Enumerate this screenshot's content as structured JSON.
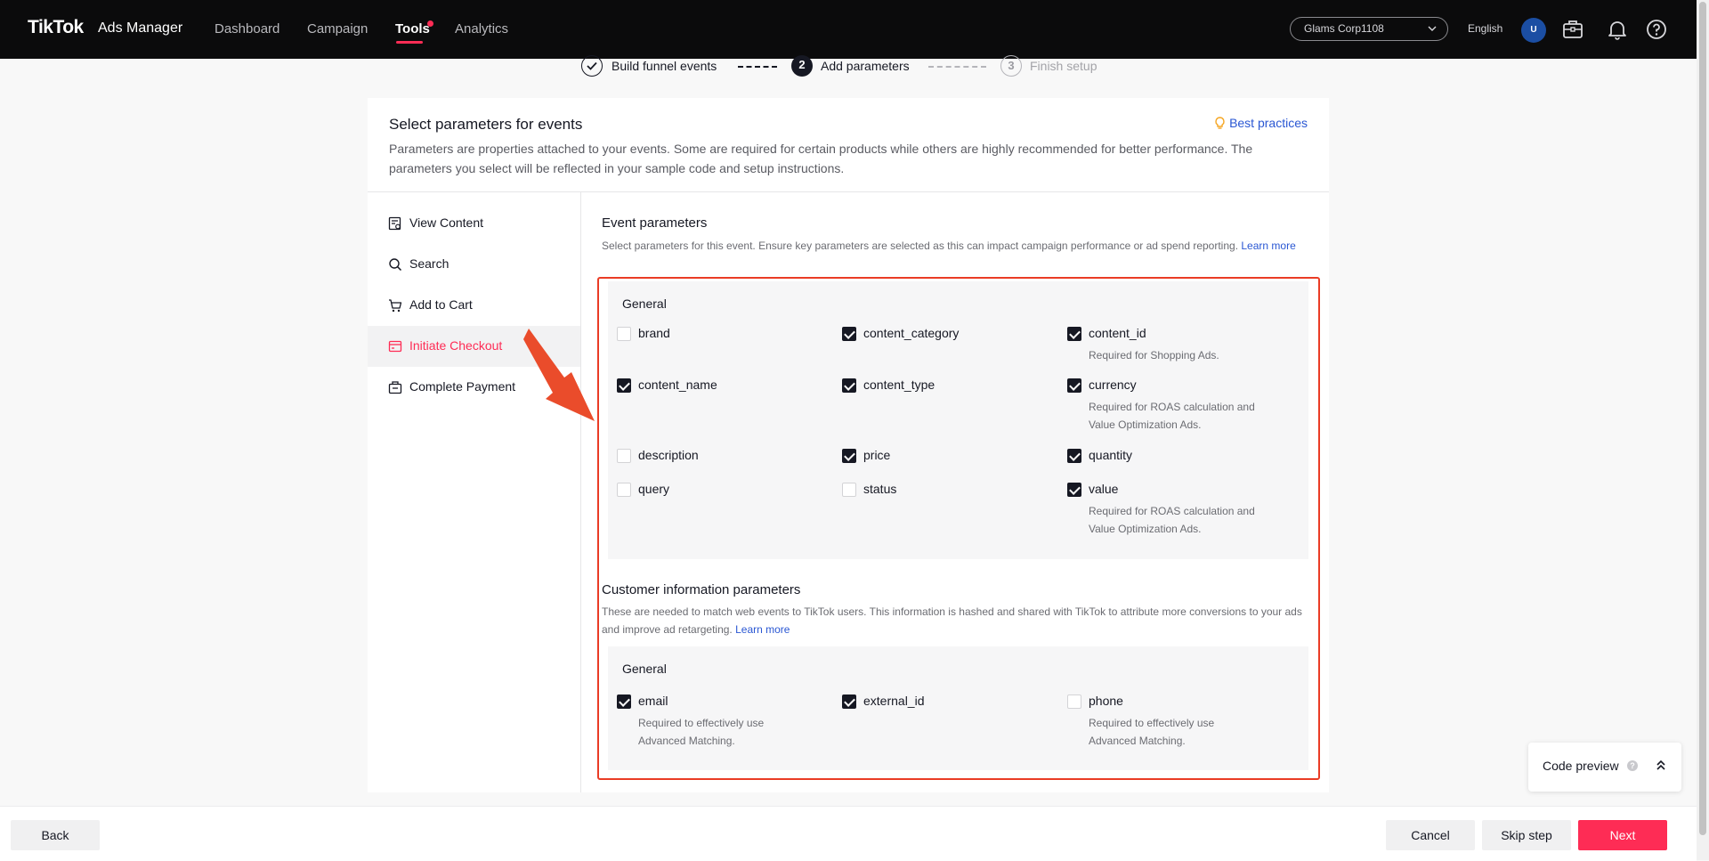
{
  "header": {
    "logo": "TikTok",
    "logo_sub": "Ads Manager",
    "nav": [
      "Dashboard",
      "Campaign",
      "Tools",
      "Analytics"
    ],
    "active_nav": "Tools",
    "account": "Glams Corp1108",
    "language": "English",
    "avatar_initial": "U",
    "icons": [
      "briefcase-icon",
      "bell-icon",
      "help-icon"
    ]
  },
  "stepper": {
    "steps": [
      {
        "number": "",
        "label": "Build funnel events",
        "state": "done"
      },
      {
        "number": "2",
        "label": "Add parameters",
        "state": "current"
      },
      {
        "number": "3",
        "label": "Finish setup",
        "state": "pending"
      }
    ]
  },
  "card": {
    "title": "Select parameters for events",
    "best_practices": "Best practices",
    "description": "Parameters are properties attached to your events. Some are required for certain products while others are highly recommended for better performance. The parameters you select will be reflected in your sample code and setup instructions."
  },
  "events": [
    {
      "label": "View Content",
      "icon": "view-content-icon",
      "active": false
    },
    {
      "label": "Search",
      "icon": "search-icon",
      "active": false
    },
    {
      "label": "Add to Cart",
      "icon": "cart-icon",
      "active": false
    },
    {
      "label": "Initiate Checkout",
      "icon": "checkout-icon",
      "active": true
    },
    {
      "label": "Complete Payment",
      "icon": "payment-icon",
      "active": false
    }
  ],
  "event_parameters": {
    "title": "Event parameters",
    "description": "Select parameters for this event. Ensure key parameters are selected as this can impact campaign performance or ad spend reporting.",
    "learn_more": "Learn more",
    "group_title": "General",
    "params": [
      {
        "name": "brand",
        "checked": false,
        "note": ""
      },
      {
        "name": "content_category",
        "checked": true,
        "note": ""
      },
      {
        "name": "content_id",
        "checked": true,
        "note": "Required for Shopping Ads."
      },
      {
        "name": "content_name",
        "checked": true,
        "note": ""
      },
      {
        "name": "content_type",
        "checked": true,
        "note": ""
      },
      {
        "name": "currency",
        "checked": true,
        "note": "Required for ROAS calculation and Value Optimization Ads."
      },
      {
        "name": "description",
        "checked": false,
        "note": ""
      },
      {
        "name": "price",
        "checked": true,
        "note": ""
      },
      {
        "name": "quantity",
        "checked": true,
        "note": ""
      },
      {
        "name": "query",
        "checked": false,
        "note": ""
      },
      {
        "name": "status",
        "checked": false,
        "note": ""
      },
      {
        "name": "value",
        "checked": true,
        "note": "Required for ROAS calculation and Value Optimization Ads."
      }
    ]
  },
  "customer_parameters": {
    "title": "Customer information parameters",
    "description": "These are needed to match web events to TikTok users. This information is hashed and shared with TikTok to attribute more conversions to your ads and improve ad retargeting.",
    "learn_more": "Learn more",
    "group_title": "General",
    "params": [
      {
        "name": "email",
        "checked": true,
        "note": "Required to effectively use Advanced Matching."
      },
      {
        "name": "external_id",
        "checked": true,
        "note": ""
      },
      {
        "name": "phone",
        "checked": false,
        "note": "Required to effectively use Advanced Matching."
      }
    ]
  },
  "code_preview": {
    "label": "Code preview"
  },
  "footer": {
    "back": "Back",
    "cancel": "Cancel",
    "skip": "Skip step",
    "next": "Next"
  },
  "colors": {
    "brand": "#fe2c55",
    "link": "#2a57d3",
    "annotation": "#ea3c25",
    "topbar": "#0b0b0c"
  }
}
